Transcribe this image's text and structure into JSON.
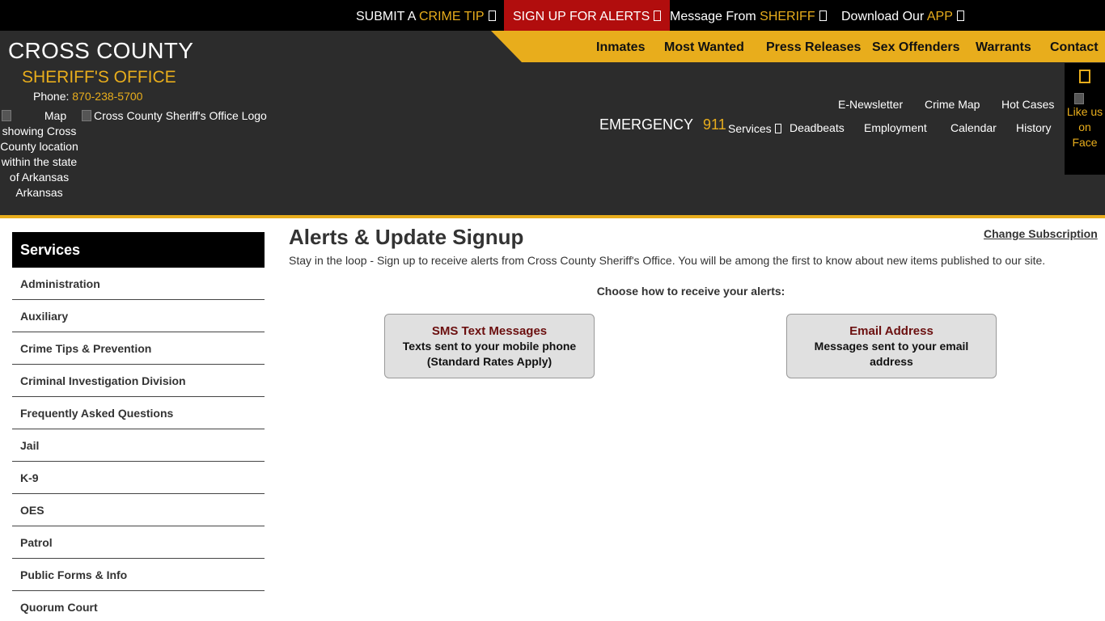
{
  "topbar": {
    "crime_tip": {
      "prefix": "SUBMIT A",
      "highlight": "CRIME TIP"
    },
    "alerts": {
      "label": "SIGN UP FOR ALERTS"
    },
    "sheriff_message": {
      "prefix": "Message From",
      "highlight": "SHERIFF"
    },
    "app": {
      "prefix": "Download Our",
      "highlight": "APP"
    }
  },
  "brand": {
    "title": "CROSS COUNTY",
    "subtitle": "SHERIFF'S OFFICE",
    "phone_label": "Phone:",
    "phone": "870-238-5700",
    "map_alt": "Map showing Cross County location within the state of Arkansas",
    "map_caption": "Arkansas",
    "logo_alt": "Cross County Sheriff's Office Logo"
  },
  "main_nav": [
    "Inmates",
    "Most Wanted",
    "Press Releases",
    "Sex Offenders",
    "Warrants",
    "Contact"
  ],
  "secondary_nav": {
    "row1": [
      "E-Newsletter",
      "Crime Map",
      "Hot Cases"
    ],
    "services": "Services",
    "row2": [
      "Deadbeats",
      "Employment",
      "Calendar",
      "History"
    ]
  },
  "emergency": {
    "label": "EMERGENCY",
    "number": "911"
  },
  "facebook": {
    "label": "Like us on Face"
  },
  "sidebar": {
    "heading": "Services",
    "items": [
      "Administration",
      "Auxiliary",
      "Crime Tips & Prevention",
      "Criminal Investigation Division",
      "Frequently Asked Questions",
      "Jail",
      "K-9",
      "OES",
      "Patrol",
      "Public Forms & Info",
      "Quorum Court"
    ]
  },
  "main": {
    "title": "Alerts & Update Signup",
    "change_subscription": "Change Subscription",
    "intro": "Stay in the loop - Sign up to receive alerts from Cross County Sheriff's Office. You will be among the first to know about new items published to our site.",
    "choose": "Choose how to receive your alerts:",
    "sms": {
      "title": "SMS Text Messages",
      "desc": "Texts sent to your mobile phone (Standard Rates Apply)"
    },
    "email": {
      "title": "Email Address",
      "desc": "Messages sent to your email address"
    }
  },
  "colors": {
    "accent": "#e8ad1c",
    "alert_red": "#b10d0d",
    "header_bg": "#2c2c2c"
  }
}
